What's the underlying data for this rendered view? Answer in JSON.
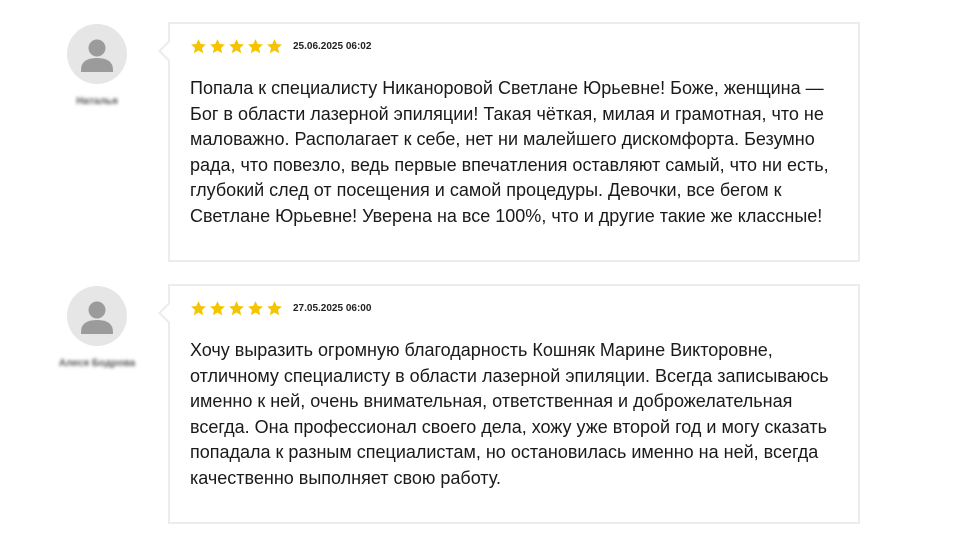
{
  "reviews": [
    {
      "author": "Наталья",
      "rating": 5,
      "date": "25.06.2025 06:02",
      "text": "Попала к специалисту Никаноровой Светлане Юрьевне! Боже, женщина — Бог в области лазерной эпиляции! Такая чёткая, милая и грамотная, что не маловажно. Располагает к себе, нет ни малейшего дискомфорта. Безумно рада, что повезло, ведь первые впечатления оставляют самый, что ни есть, глубокий след от посещения и самой процедуры. Девочки, все бегом к Светлане Юрьевне! Уверена на все 100%, что и другие такие же классные!"
    },
    {
      "author": "Алеся Бодрова",
      "rating": 5,
      "date": "27.05.2025 06:00",
      "text": "Хочу выразить огромную благодарность Кошняк Марине Викторовне, отличному специалисту в области лазерной эпиляции. Всегда записываюсь именно к ней, очень внимательная, ответственная и доброжелательная всегда. Она профессионал своего дела, хожу уже второй год и могу сказать попадала к разным специалистам, но остановилась именно на ней, всегда качественно выполняет свою работу."
    }
  ],
  "colors": {
    "star": "#f5c400",
    "card_border": "#ececec",
    "avatar_bg": "#e6e6e6",
    "avatar_figure": "#9b9b9b"
  },
  "icons": {
    "avatar": "user-silhouette-icon",
    "rating": "star-icon"
  }
}
